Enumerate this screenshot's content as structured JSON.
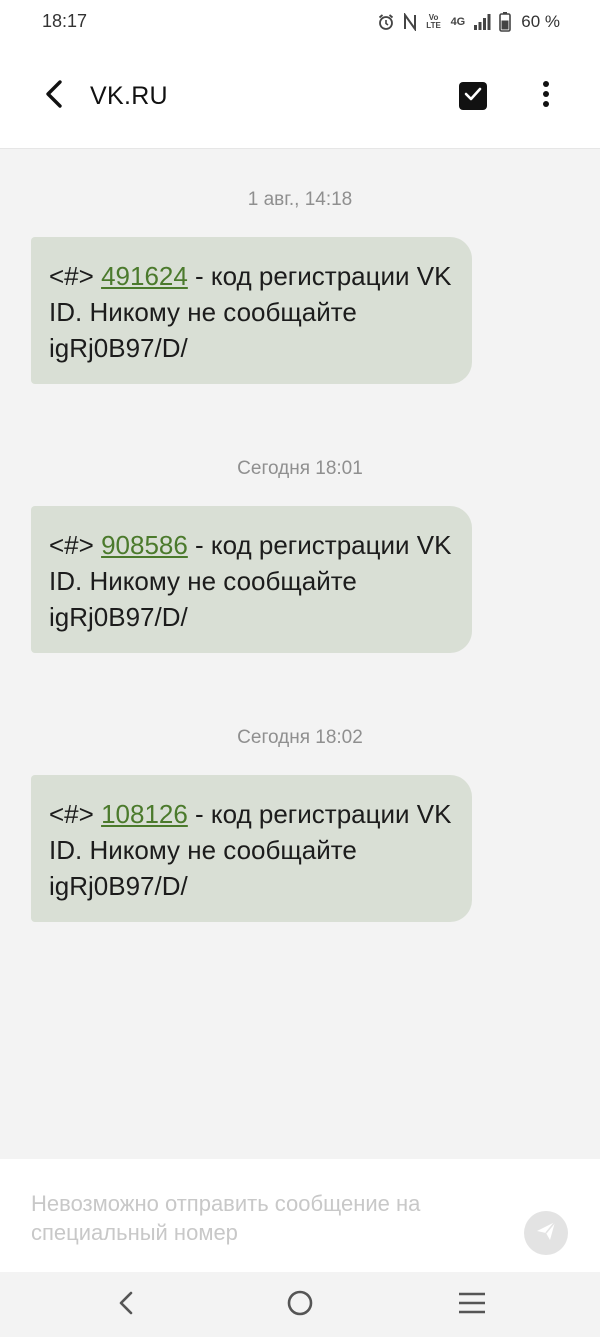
{
  "status_bar": {
    "time": "18:17",
    "network_label": "4G",
    "volte_label": "Vo LTE",
    "battery_percent": "60 %",
    "icons": [
      "alarm-icon",
      "nfc-icon",
      "volte-icon",
      "4g-icon",
      "signal-icon",
      "battery-icon"
    ]
  },
  "header": {
    "title": "VK.RU",
    "icons": [
      "back-arrow-icon",
      "select-checkbox-icon",
      "more-vert-icon"
    ]
  },
  "messages": [
    {
      "timestamp": "1 авг., 14:18",
      "prefix": "<#> ",
      "code": "491624",
      "text": " - код регистрации VK ID. Никому не сообщайте igRj0B97/D/"
    },
    {
      "timestamp": "Сегодня 18:01",
      "prefix": "<#> ",
      "code": "908586",
      "text": " - код регистрации VK ID. Никому не сообщайте igRj0B97/D/"
    },
    {
      "timestamp": "Сегодня 18:02",
      "prefix": "<#> ",
      "code": "108126",
      "text": " - код регистрации VK ID. Никому не сообщайте igRj0B97/D/"
    }
  ],
  "composer": {
    "notice": "Невозможно отправить сообщение на специальный номер",
    "send_icon": "send-icon"
  },
  "nav_bar": {
    "icons": [
      "nav-back-icon",
      "nav-home-icon",
      "nav-recents-icon"
    ]
  },
  "colors": {
    "bubble": "#d9dfd5",
    "code_link": "#4b7a2c",
    "timestamp": "#8f8f8f",
    "background": "#f3f3f3"
  }
}
